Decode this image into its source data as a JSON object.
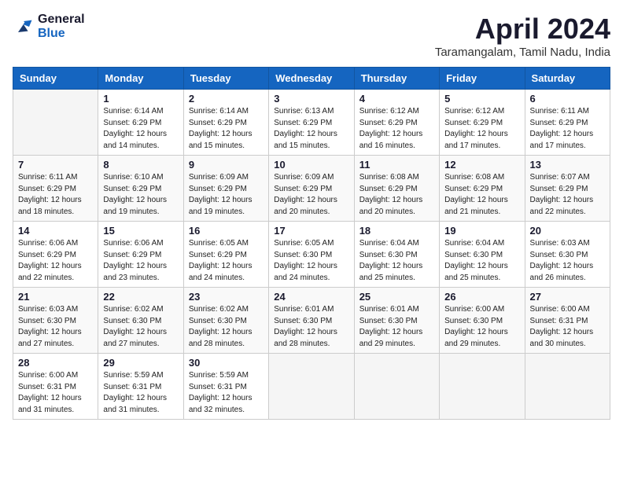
{
  "logo": {
    "line1": "General",
    "line2": "Blue"
  },
  "title": "April 2024",
  "location": "Taramangalam, Tamil Nadu, India",
  "days_of_week": [
    "Sunday",
    "Monday",
    "Tuesday",
    "Wednesday",
    "Thursday",
    "Friday",
    "Saturday"
  ],
  "weeks": [
    [
      {
        "day": "",
        "sunrise": "",
        "sunset": "",
        "daylight": ""
      },
      {
        "day": "1",
        "sunrise": "Sunrise: 6:14 AM",
        "sunset": "Sunset: 6:29 PM",
        "daylight": "Daylight: 12 hours and 14 minutes."
      },
      {
        "day": "2",
        "sunrise": "Sunrise: 6:14 AM",
        "sunset": "Sunset: 6:29 PM",
        "daylight": "Daylight: 12 hours and 15 minutes."
      },
      {
        "day": "3",
        "sunrise": "Sunrise: 6:13 AM",
        "sunset": "Sunset: 6:29 PM",
        "daylight": "Daylight: 12 hours and 15 minutes."
      },
      {
        "day": "4",
        "sunrise": "Sunrise: 6:12 AM",
        "sunset": "Sunset: 6:29 PM",
        "daylight": "Daylight: 12 hours and 16 minutes."
      },
      {
        "day": "5",
        "sunrise": "Sunrise: 6:12 AM",
        "sunset": "Sunset: 6:29 PM",
        "daylight": "Daylight: 12 hours and 17 minutes."
      },
      {
        "day": "6",
        "sunrise": "Sunrise: 6:11 AM",
        "sunset": "Sunset: 6:29 PM",
        "daylight": "Daylight: 12 hours and 17 minutes."
      }
    ],
    [
      {
        "day": "7",
        "sunrise": "Sunrise: 6:11 AM",
        "sunset": "Sunset: 6:29 PM",
        "daylight": "Daylight: 12 hours and 18 minutes."
      },
      {
        "day": "8",
        "sunrise": "Sunrise: 6:10 AM",
        "sunset": "Sunset: 6:29 PM",
        "daylight": "Daylight: 12 hours and 19 minutes."
      },
      {
        "day": "9",
        "sunrise": "Sunrise: 6:09 AM",
        "sunset": "Sunset: 6:29 PM",
        "daylight": "Daylight: 12 hours and 19 minutes."
      },
      {
        "day": "10",
        "sunrise": "Sunrise: 6:09 AM",
        "sunset": "Sunset: 6:29 PM",
        "daylight": "Daylight: 12 hours and 20 minutes."
      },
      {
        "day": "11",
        "sunrise": "Sunrise: 6:08 AM",
        "sunset": "Sunset: 6:29 PM",
        "daylight": "Daylight: 12 hours and 20 minutes."
      },
      {
        "day": "12",
        "sunrise": "Sunrise: 6:08 AM",
        "sunset": "Sunset: 6:29 PM",
        "daylight": "Daylight: 12 hours and 21 minutes."
      },
      {
        "day": "13",
        "sunrise": "Sunrise: 6:07 AM",
        "sunset": "Sunset: 6:29 PM",
        "daylight": "Daylight: 12 hours and 22 minutes."
      }
    ],
    [
      {
        "day": "14",
        "sunrise": "Sunrise: 6:06 AM",
        "sunset": "Sunset: 6:29 PM",
        "daylight": "Daylight: 12 hours and 22 minutes."
      },
      {
        "day": "15",
        "sunrise": "Sunrise: 6:06 AM",
        "sunset": "Sunset: 6:29 PM",
        "daylight": "Daylight: 12 hours and 23 minutes."
      },
      {
        "day": "16",
        "sunrise": "Sunrise: 6:05 AM",
        "sunset": "Sunset: 6:29 PM",
        "daylight": "Daylight: 12 hours and 24 minutes."
      },
      {
        "day": "17",
        "sunrise": "Sunrise: 6:05 AM",
        "sunset": "Sunset: 6:30 PM",
        "daylight": "Daylight: 12 hours and 24 minutes."
      },
      {
        "day": "18",
        "sunrise": "Sunrise: 6:04 AM",
        "sunset": "Sunset: 6:30 PM",
        "daylight": "Daylight: 12 hours and 25 minutes."
      },
      {
        "day": "19",
        "sunrise": "Sunrise: 6:04 AM",
        "sunset": "Sunset: 6:30 PM",
        "daylight": "Daylight: 12 hours and 25 minutes."
      },
      {
        "day": "20",
        "sunrise": "Sunrise: 6:03 AM",
        "sunset": "Sunset: 6:30 PM",
        "daylight": "Daylight: 12 hours and 26 minutes."
      }
    ],
    [
      {
        "day": "21",
        "sunrise": "Sunrise: 6:03 AM",
        "sunset": "Sunset: 6:30 PM",
        "daylight": "Daylight: 12 hours and 27 minutes."
      },
      {
        "day": "22",
        "sunrise": "Sunrise: 6:02 AM",
        "sunset": "Sunset: 6:30 PM",
        "daylight": "Daylight: 12 hours and 27 minutes."
      },
      {
        "day": "23",
        "sunrise": "Sunrise: 6:02 AM",
        "sunset": "Sunset: 6:30 PM",
        "daylight": "Daylight: 12 hours and 28 minutes."
      },
      {
        "day": "24",
        "sunrise": "Sunrise: 6:01 AM",
        "sunset": "Sunset: 6:30 PM",
        "daylight": "Daylight: 12 hours and 28 minutes."
      },
      {
        "day": "25",
        "sunrise": "Sunrise: 6:01 AM",
        "sunset": "Sunset: 6:30 PM",
        "daylight": "Daylight: 12 hours and 29 minutes."
      },
      {
        "day": "26",
        "sunrise": "Sunrise: 6:00 AM",
        "sunset": "Sunset: 6:30 PM",
        "daylight": "Daylight: 12 hours and 29 minutes."
      },
      {
        "day": "27",
        "sunrise": "Sunrise: 6:00 AM",
        "sunset": "Sunset: 6:31 PM",
        "daylight": "Daylight: 12 hours and 30 minutes."
      }
    ],
    [
      {
        "day": "28",
        "sunrise": "Sunrise: 6:00 AM",
        "sunset": "Sunset: 6:31 PM",
        "daylight": "Daylight: 12 hours and 31 minutes."
      },
      {
        "day": "29",
        "sunrise": "Sunrise: 5:59 AM",
        "sunset": "Sunset: 6:31 PM",
        "daylight": "Daylight: 12 hours and 31 minutes."
      },
      {
        "day": "30",
        "sunrise": "Sunrise: 5:59 AM",
        "sunset": "Sunset: 6:31 PM",
        "daylight": "Daylight: 12 hours and 32 minutes."
      },
      {
        "day": "",
        "sunrise": "",
        "sunset": "",
        "daylight": ""
      },
      {
        "day": "",
        "sunrise": "",
        "sunset": "",
        "daylight": ""
      },
      {
        "day": "",
        "sunrise": "",
        "sunset": "",
        "daylight": ""
      },
      {
        "day": "",
        "sunrise": "",
        "sunset": "",
        "daylight": ""
      }
    ]
  ]
}
